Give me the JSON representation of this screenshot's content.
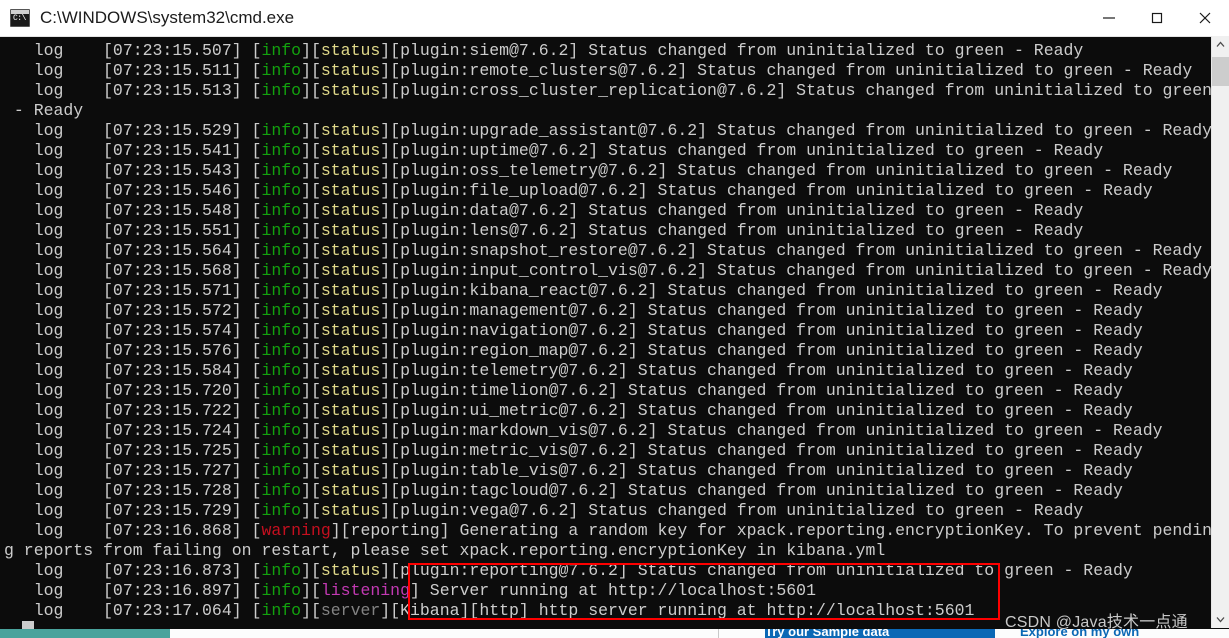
{
  "window": {
    "title": "C:\\WINDOWS\\system32\\cmd.exe",
    "icon": "cmd-console-icon",
    "minimize_label": "—",
    "maximize_label": "□",
    "close_label": "✕"
  },
  "colors": {
    "background": "#0c0c0c",
    "text": "#cccccc",
    "info": "#13a10e",
    "status": "#e0d98a",
    "warning": "#c50f1f",
    "listening": "#c239b3",
    "server": "#838383",
    "annotation": "#fe0000",
    "titlebar": "#ffffff"
  },
  "console": {
    "prompt_prefix": "log",
    "lines": [
      {
        "segs": [
          {
            "t": "   log    [07:23:15.507] [",
            "c": "white"
          },
          {
            "t": "info",
            "c": "info"
          },
          {
            "t": "][",
            "c": "white"
          },
          {
            "t": "status",
            "c": "status"
          },
          {
            "t": "][plugin:siem@7.6.2] Status changed from uninitialized to green - Ready",
            "c": "white"
          }
        ]
      },
      {
        "segs": [
          {
            "t": "   log    [07:23:15.511] [",
            "c": "white"
          },
          {
            "t": "info",
            "c": "info"
          },
          {
            "t": "][",
            "c": "white"
          },
          {
            "t": "status",
            "c": "status"
          },
          {
            "t": "][plugin:remote_clusters@7.6.2] Status changed from uninitialized to green - Ready",
            "c": "white"
          }
        ]
      },
      {
        "segs": [
          {
            "t": "   log    [07:23:15.513] [",
            "c": "white"
          },
          {
            "t": "info",
            "c": "info"
          },
          {
            "t": "][",
            "c": "white"
          },
          {
            "t": "status",
            "c": "status"
          },
          {
            "t": "][plugin:cross_cluster_replication@7.6.2] Status changed from uninitialized to green",
            "c": "white"
          }
        ]
      },
      {
        "segs": [
          {
            "t": " - Ready",
            "c": "white"
          }
        ]
      },
      {
        "segs": [
          {
            "t": "   log    [07:23:15.529] [",
            "c": "white"
          },
          {
            "t": "info",
            "c": "info"
          },
          {
            "t": "][",
            "c": "white"
          },
          {
            "t": "status",
            "c": "status"
          },
          {
            "t": "][plugin:upgrade_assistant@7.6.2] Status changed from uninitialized to green - Ready",
            "c": "white"
          }
        ]
      },
      {
        "segs": [
          {
            "t": "   log    [07:23:15.541] [",
            "c": "white"
          },
          {
            "t": "info",
            "c": "info"
          },
          {
            "t": "][",
            "c": "white"
          },
          {
            "t": "status",
            "c": "status"
          },
          {
            "t": "][plugin:uptime@7.6.2] Status changed from uninitialized to green - Ready",
            "c": "white"
          }
        ]
      },
      {
        "segs": [
          {
            "t": "   log    [07:23:15.543] [",
            "c": "white"
          },
          {
            "t": "info",
            "c": "info"
          },
          {
            "t": "][",
            "c": "white"
          },
          {
            "t": "status",
            "c": "status"
          },
          {
            "t": "][plugin:oss_telemetry@7.6.2] Status changed from uninitialized to green - Ready",
            "c": "white"
          }
        ]
      },
      {
        "segs": [
          {
            "t": "   log    [07:23:15.546] [",
            "c": "white"
          },
          {
            "t": "info",
            "c": "info"
          },
          {
            "t": "][",
            "c": "white"
          },
          {
            "t": "status",
            "c": "status"
          },
          {
            "t": "][plugin:file_upload@7.6.2] Status changed from uninitialized to green - Ready",
            "c": "white"
          }
        ]
      },
      {
        "segs": [
          {
            "t": "   log    [07:23:15.548] [",
            "c": "white"
          },
          {
            "t": "info",
            "c": "info"
          },
          {
            "t": "][",
            "c": "white"
          },
          {
            "t": "status",
            "c": "status"
          },
          {
            "t": "][plugin:data@7.6.2] Status changed from uninitialized to green - Ready",
            "c": "white"
          }
        ]
      },
      {
        "segs": [
          {
            "t": "   log    [07:23:15.551] [",
            "c": "white"
          },
          {
            "t": "info",
            "c": "info"
          },
          {
            "t": "][",
            "c": "white"
          },
          {
            "t": "status",
            "c": "status"
          },
          {
            "t": "][plugin:lens@7.6.2] Status changed from uninitialized to green - Ready",
            "c": "white"
          }
        ]
      },
      {
        "segs": [
          {
            "t": "   log    [07:23:15.564] [",
            "c": "white"
          },
          {
            "t": "info",
            "c": "info"
          },
          {
            "t": "][",
            "c": "white"
          },
          {
            "t": "status",
            "c": "status"
          },
          {
            "t": "][plugin:snapshot_restore@7.6.2] Status changed from uninitialized to green - Ready",
            "c": "white"
          }
        ]
      },
      {
        "segs": [
          {
            "t": "   log    [07:23:15.568] [",
            "c": "white"
          },
          {
            "t": "info",
            "c": "info"
          },
          {
            "t": "][",
            "c": "white"
          },
          {
            "t": "status",
            "c": "status"
          },
          {
            "t": "][plugin:input_control_vis@7.6.2] Status changed from uninitialized to green - Ready",
            "c": "white"
          }
        ]
      },
      {
        "segs": [
          {
            "t": "   log    [07:23:15.571] [",
            "c": "white"
          },
          {
            "t": "info",
            "c": "info"
          },
          {
            "t": "][",
            "c": "white"
          },
          {
            "t": "status",
            "c": "status"
          },
          {
            "t": "][plugin:kibana_react@7.6.2] Status changed from uninitialized to green - Ready",
            "c": "white"
          }
        ]
      },
      {
        "segs": [
          {
            "t": "   log    [07:23:15.572] [",
            "c": "white"
          },
          {
            "t": "info",
            "c": "info"
          },
          {
            "t": "][",
            "c": "white"
          },
          {
            "t": "status",
            "c": "status"
          },
          {
            "t": "][plugin:management@7.6.2] Status changed from uninitialized to green - Ready",
            "c": "white"
          }
        ]
      },
      {
        "segs": [
          {
            "t": "   log    [07:23:15.574] [",
            "c": "white"
          },
          {
            "t": "info",
            "c": "info"
          },
          {
            "t": "][",
            "c": "white"
          },
          {
            "t": "status",
            "c": "status"
          },
          {
            "t": "][plugin:navigation@7.6.2] Status changed from uninitialized to green - Ready",
            "c": "white"
          }
        ]
      },
      {
        "segs": [
          {
            "t": "   log    [07:23:15.576] [",
            "c": "white"
          },
          {
            "t": "info",
            "c": "info"
          },
          {
            "t": "][",
            "c": "white"
          },
          {
            "t": "status",
            "c": "status"
          },
          {
            "t": "][plugin:region_map@7.6.2] Status changed from uninitialized to green - Ready",
            "c": "white"
          }
        ]
      },
      {
        "segs": [
          {
            "t": "   log    [07:23:15.584] [",
            "c": "white"
          },
          {
            "t": "info",
            "c": "info"
          },
          {
            "t": "][",
            "c": "white"
          },
          {
            "t": "status",
            "c": "status"
          },
          {
            "t": "][plugin:telemetry@7.6.2] Status changed from uninitialized to green - Ready",
            "c": "white"
          }
        ]
      },
      {
        "segs": [
          {
            "t": "   log    [07:23:15.720] [",
            "c": "white"
          },
          {
            "t": "info",
            "c": "info"
          },
          {
            "t": "][",
            "c": "white"
          },
          {
            "t": "status",
            "c": "status"
          },
          {
            "t": "][plugin:timelion@7.6.2] Status changed from uninitialized to green - Ready",
            "c": "white"
          }
        ]
      },
      {
        "segs": [
          {
            "t": "   log    [07:23:15.722] [",
            "c": "white"
          },
          {
            "t": "info",
            "c": "info"
          },
          {
            "t": "][",
            "c": "white"
          },
          {
            "t": "status",
            "c": "status"
          },
          {
            "t": "][plugin:ui_metric@7.6.2] Status changed from uninitialized to green - Ready",
            "c": "white"
          }
        ]
      },
      {
        "segs": [
          {
            "t": "   log    [07:23:15.724] [",
            "c": "white"
          },
          {
            "t": "info",
            "c": "info"
          },
          {
            "t": "][",
            "c": "white"
          },
          {
            "t": "status",
            "c": "status"
          },
          {
            "t": "][plugin:markdown_vis@7.6.2] Status changed from uninitialized to green - Ready",
            "c": "white"
          }
        ]
      },
      {
        "segs": [
          {
            "t": "   log    [07:23:15.725] [",
            "c": "white"
          },
          {
            "t": "info",
            "c": "info"
          },
          {
            "t": "][",
            "c": "white"
          },
          {
            "t": "status",
            "c": "status"
          },
          {
            "t": "][plugin:metric_vis@7.6.2] Status changed from uninitialized to green - Ready",
            "c": "white"
          }
        ]
      },
      {
        "segs": [
          {
            "t": "   log    [07:23:15.727] [",
            "c": "white"
          },
          {
            "t": "info",
            "c": "info"
          },
          {
            "t": "][",
            "c": "white"
          },
          {
            "t": "status",
            "c": "status"
          },
          {
            "t": "][plugin:table_vis@7.6.2] Status changed from uninitialized to green - Ready",
            "c": "white"
          }
        ]
      },
      {
        "segs": [
          {
            "t": "   log    [07:23:15.728] [",
            "c": "white"
          },
          {
            "t": "info",
            "c": "info"
          },
          {
            "t": "][",
            "c": "white"
          },
          {
            "t": "status",
            "c": "status"
          },
          {
            "t": "][plugin:tagcloud@7.6.2] Status changed from uninitialized to green - Ready",
            "c": "white"
          }
        ]
      },
      {
        "segs": [
          {
            "t": "   log    [07:23:15.729] [",
            "c": "white"
          },
          {
            "t": "info",
            "c": "info"
          },
          {
            "t": "][",
            "c": "white"
          },
          {
            "t": "status",
            "c": "status"
          },
          {
            "t": "][plugin:vega@7.6.2] Status changed from uninitialized to green - Ready",
            "c": "white"
          }
        ]
      },
      {
        "segs": [
          {
            "t": "   log    [07:23:16.868] [",
            "c": "white"
          },
          {
            "t": "warning",
            "c": "warning"
          },
          {
            "t": "][reporting] Generating a random key for xpack.reporting.encryptionKey. To prevent pendin",
            "c": "white"
          }
        ]
      },
      {
        "segs": [
          {
            "t": "g reports from failing on restart, please set xpack.reporting.encryptionKey in kibana.yml",
            "c": "white"
          }
        ]
      },
      {
        "segs": [
          {
            "t": "   log    [07:23:16.873] [",
            "c": "white"
          },
          {
            "t": "info",
            "c": "info"
          },
          {
            "t": "][",
            "c": "white"
          },
          {
            "t": "status",
            "c": "status"
          },
          {
            "t": "][plugin:reporting@7.6.2] Status changed from uninitialized to green - Ready",
            "c": "white"
          }
        ]
      },
      {
        "segs": [
          {
            "t": "   log    [07:23:16.897] [",
            "c": "white"
          },
          {
            "t": "info",
            "c": "info"
          },
          {
            "t": "][",
            "c": "white"
          },
          {
            "t": "listening",
            "c": "listening"
          },
          {
            "t": "] Server running at http://localhost:5601",
            "c": "white"
          }
        ]
      },
      {
        "segs": [
          {
            "t": "   log    [07:23:17.064] [",
            "c": "white"
          },
          {
            "t": "info",
            "c": "info"
          },
          {
            "t": "][",
            "c": "white"
          },
          {
            "t": "server",
            "c": "server"
          },
          {
            "t": "][Kibana][http] http server running at http://localhost:5601",
            "c": "white"
          }
        ]
      }
    ]
  },
  "annotation": {
    "kind": "red-rectangle-highlight",
    "highlights": [
      "Server running at http://localhost:5601",
      "http server running at http://localhost:5601"
    ]
  },
  "watermark": {
    "text": "CSDN @Java技术一点通"
  },
  "background": {
    "button_primary": "Try our Sample data",
    "button_secondary": "Explore on my own"
  },
  "scrollbar": {
    "up_arrow": "⌃",
    "down_arrow": "⌄"
  }
}
